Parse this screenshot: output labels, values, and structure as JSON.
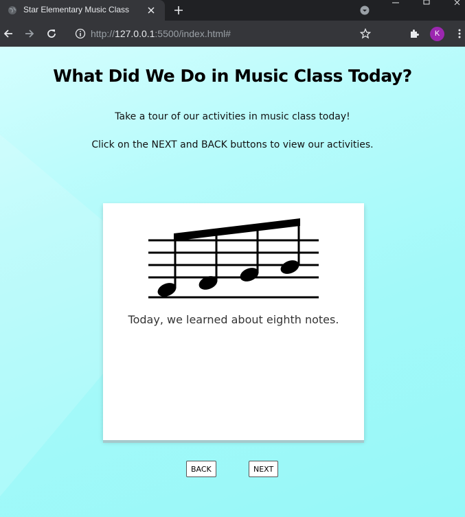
{
  "browser": {
    "tab_title": "Star Elementary Music Class",
    "url_prefix": "http://",
    "url_host": "127.0.0.1",
    "url_rest": ":5500/index.html#",
    "profile_initial": "K"
  },
  "page": {
    "heading": "What Did We Do in Music Class Today?",
    "intro_line1": "Take a tour of our activities in music class today!",
    "intro_line2": "Click on the NEXT and BACK buttons to view our activities.",
    "slide": {
      "image": "eighth-notes-icon",
      "caption": "Today, we learned about eighth notes."
    },
    "back_label": "BACK",
    "next_label": "NEXT"
  },
  "colors": {
    "page_background": "#9ff8f8",
    "card": "#ffffff",
    "browser_frame": "#35363a",
    "avatar": "#9c27b0"
  }
}
